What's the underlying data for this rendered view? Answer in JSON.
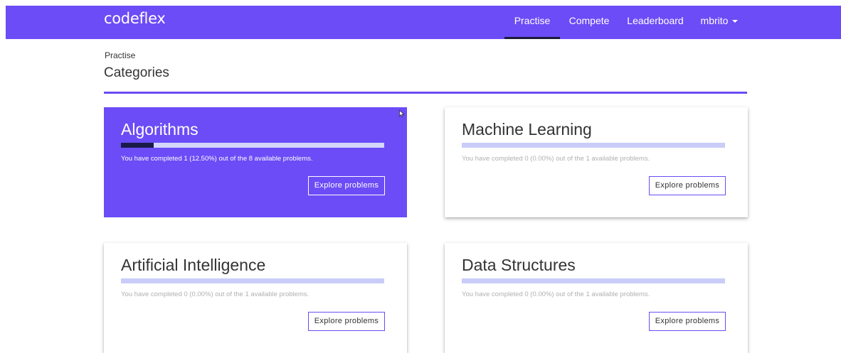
{
  "navbar": {
    "brand": "codeflex",
    "items": [
      {
        "label": "Practise",
        "active": true
      },
      {
        "label": "Compete",
        "active": false
      },
      {
        "label": "Leaderboard",
        "active": false
      }
    ],
    "user": {
      "label": "mbrito"
    }
  },
  "breadcrumb": "Practise",
  "page_title": "Categories",
  "cards": [
    {
      "title": "Algorithms",
      "progress_text": "You have completed 1 (12.50%) out of the 8 available problems.",
      "progress": 0.125,
      "button_label": "Explore problems",
      "highlighted": true
    },
    {
      "title": "Machine Learning",
      "progress_text": "You have completed 0 (0.00%) out of the 1 available problems.",
      "progress": 0.0,
      "button_label": "Explore problems",
      "highlighted": false
    },
    {
      "title": "Artificial Intelligence",
      "progress_text": "You have completed 0 (0.00%) out of the 1 available problems.",
      "progress": 0.0,
      "button_label": "Explore problems",
      "highlighted": false
    },
    {
      "title": "Data Structures",
      "progress_text": "You have completed 0 (0.00%) out of the 1 available problems.",
      "progress": 0.0,
      "button_label": "Explore problems",
      "highlighted": false
    }
  ],
  "colors": {
    "accent": "#6b4cf6",
    "progress_fill": "#1b1b4a",
    "progress_track": "#c9cdf7"
  },
  "icons": {
    "user_menu": "caret-down-icon",
    "pointer": "mouse-cursor-icon"
  }
}
